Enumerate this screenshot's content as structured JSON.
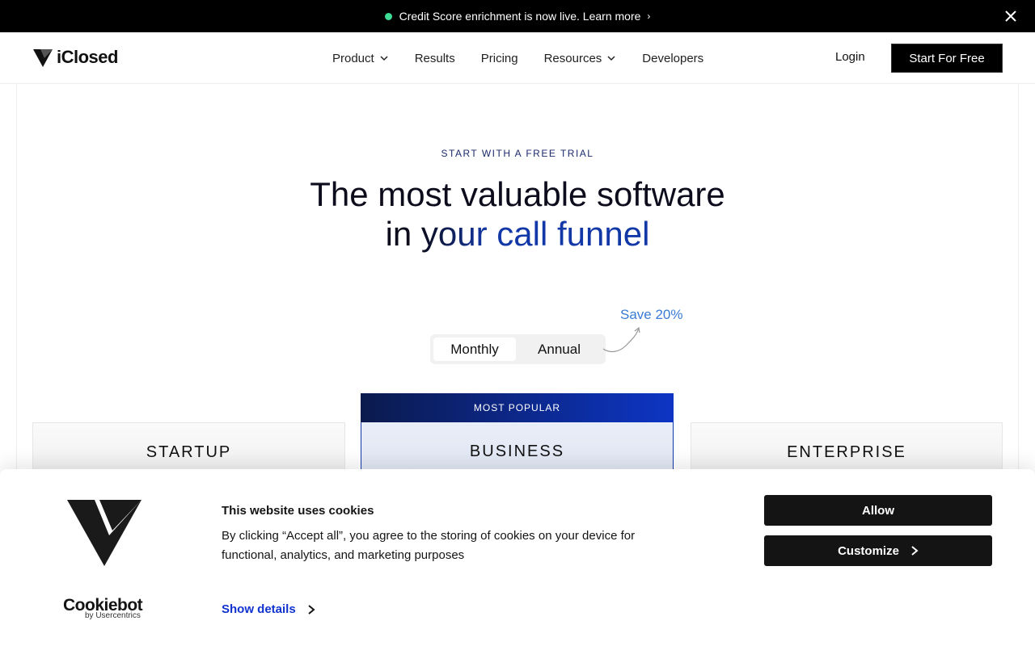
{
  "announcement": {
    "text": "Credit Score enrichment is now live. Learn more",
    "chevron": "›",
    "dot_color": "#3ddc97"
  },
  "nav": {
    "logo_text": "iClosed",
    "items": [
      {
        "label": "Product",
        "has_caret": true
      },
      {
        "label": "Results",
        "has_caret": false
      },
      {
        "label": "Pricing",
        "has_caret": false
      },
      {
        "label": "Resources",
        "has_caret": true
      },
      {
        "label": "Developers",
        "has_caret": false
      }
    ],
    "caret": "⌄",
    "login": "Login",
    "cta": "Start For Free"
  },
  "hero": {
    "eyebrow": "START WITH A FREE TRIAL",
    "line1": "The most valuable software",
    "line2_a": "in ",
    "line2_b": "your",
    "line2_c": " call funnel"
  },
  "billing": {
    "monthly": "Monthly",
    "annual": "Annual",
    "selected": "Monthly",
    "save": "Save 20%"
  },
  "pricing": {
    "most_popular": "MOST POPULAR",
    "plans": [
      "STARTUP",
      "BUSINESS",
      "ENTERPRISE"
    ],
    "accent": "#1238a8"
  },
  "cookie": {
    "title": "This website uses cookies",
    "text": "By clicking “Accept all”, you agree to the storing of cookies on your device for functional, analytics, and marketing purposes",
    "show_details": "Show details",
    "chevron": "›",
    "allow": "Allow",
    "customize": "Customize",
    "brand": "Cookiebot",
    "brand_sub": "by Usercentrics"
  }
}
